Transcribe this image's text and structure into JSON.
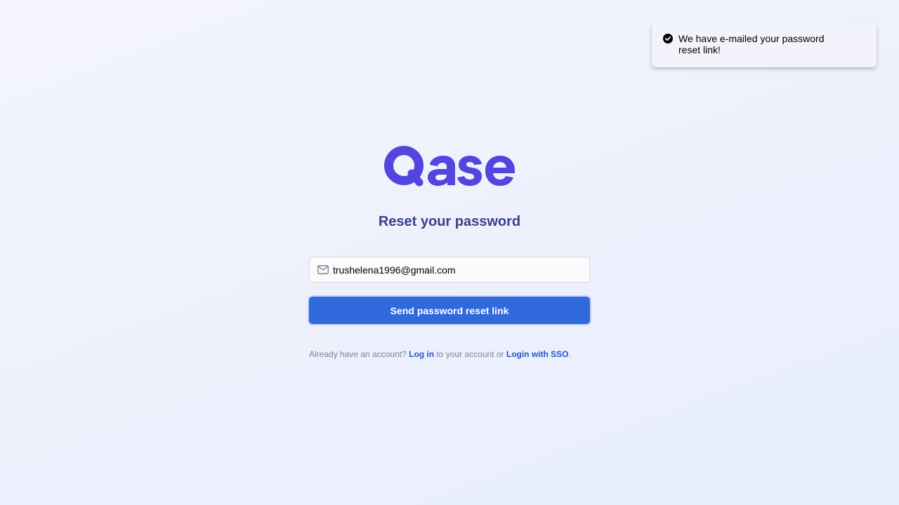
{
  "toast": {
    "icon": "check-circle-icon",
    "message": "We have e-mailed your password reset link!"
  },
  "brand": {
    "logo_text": "Qase",
    "logo_color": "#5246de"
  },
  "page": {
    "title": "Reset your password"
  },
  "form": {
    "email_icon": "envelope-icon",
    "email_value": "trushelena1996@gmail.com",
    "submit_label": "Send password reset link",
    "accent_color": "#2f69dc"
  },
  "footer": {
    "prefix": "Already have an account?",
    "login_link": "Log in",
    "middle": "to your account or",
    "sso_link": "Login with SSO",
    "suffix": "."
  }
}
